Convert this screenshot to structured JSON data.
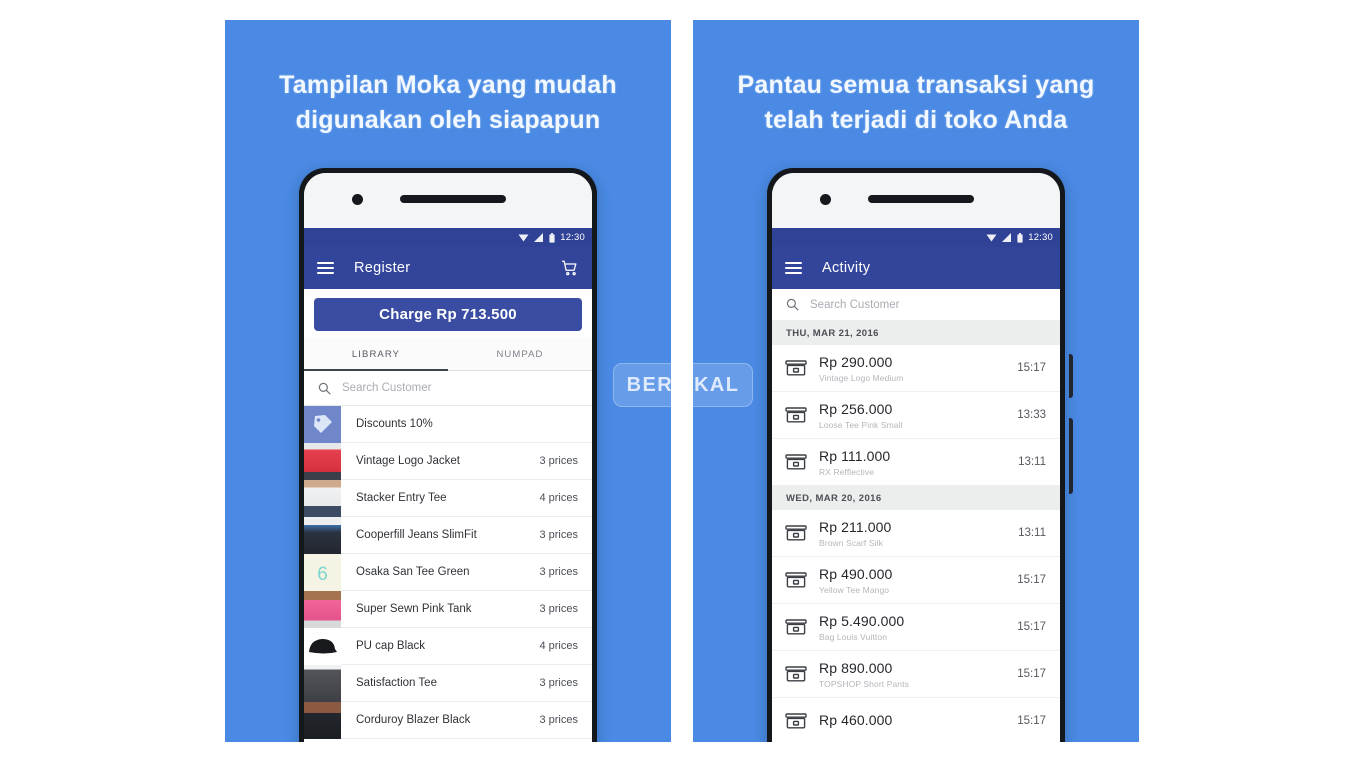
{
  "theme": {
    "panel_blue": "#4a8ae4",
    "appbar_navy": "#33449b",
    "statusbar_navy": "#2f4296",
    "charge_button": "#3a4da3",
    "page_background": "#ffffff"
  },
  "watermark": {
    "text_before": "BER",
    "text_after": "KAL",
    "logo_name": "berakal-logo"
  },
  "panels": [
    {
      "heading": "Tampilan Moka yang mudah digunakan oleh siapapun",
      "phone": {
        "status": {
          "time": "12:30",
          "icons": [
            "wifi-icon",
            "signal-icon",
            "battery-icon"
          ]
        },
        "appbar": {
          "menu": "menu-icon",
          "title": "Register",
          "action": "cart-icon"
        },
        "charge_button": "Charge Rp 713.500",
        "tabs": [
          {
            "label": "LIBRARY",
            "active": true
          },
          {
            "label": "NUMPAD",
            "active": false
          }
        ],
        "search": {
          "placeholder": "Search Customer",
          "icon": "search-icon"
        },
        "products": [
          {
            "name": "Discounts 10%",
            "price": "",
            "thumb": "tag"
          },
          {
            "name": "Vintage Logo Jacket",
            "price": "3 prices",
            "thumb": "red-jacket"
          },
          {
            "name": "Stacker Entry Tee",
            "price": "4 prices",
            "thumb": "white-tank"
          },
          {
            "name": "Cooperfill Jeans SlimFit",
            "price": "3 prices",
            "thumb": "dark-jeans"
          },
          {
            "name": "Osaka San Tee Green",
            "price": "3 prices",
            "thumb": "cream-tee"
          },
          {
            "name": "Super Sewn Pink Tank",
            "price": "3 prices",
            "thumb": "pink-tank"
          },
          {
            "name": "PU cap Black",
            "price": "4 prices",
            "thumb": "black-cap"
          },
          {
            "name": "Satisfaction Tee",
            "price": "3 prices",
            "thumb": "grey-tee"
          },
          {
            "name": "Corduroy Blazer Black",
            "price": "3 prices",
            "thumb": "dark-blazer"
          }
        ]
      }
    },
    {
      "heading": "Pantau semua transaksi yang telah terjadi di toko Anda",
      "phone": {
        "status": {
          "time": "12:30",
          "icons": [
            "wifi-icon",
            "signal-icon",
            "battery-icon"
          ]
        },
        "appbar": {
          "menu": "menu-icon",
          "title": "Activity"
        },
        "search": {
          "placeholder": "Search Customer",
          "icon": "search-icon"
        },
        "groups": [
          {
            "date": "THU, MAR 21, 2016",
            "transactions": [
              {
                "amount": "Rp 290.000",
                "item": "Vintage Logo Medium",
                "time": "15:17"
              },
              {
                "amount": "Rp 256.000",
                "item": "Loose Tee Pink Small",
                "time": "13:33"
              },
              {
                "amount": "Rp 111.000",
                "item": "RX Refflective",
                "time": "13:11"
              }
            ]
          },
          {
            "date": "WED, MAR 20, 2016",
            "transactions": [
              {
                "amount": "Rp 211.000",
                "item": "Brown Scarf Silk",
                "time": "13:11"
              },
              {
                "amount": "Rp 490.000",
                "item": "Yellow Tee Mango",
                "time": "15:17"
              },
              {
                "amount": "Rp 5.490.000",
                "item": "Bag Louis Vuitton",
                "time": "15:17"
              },
              {
                "amount": "Rp 890.000",
                "item": "TOPSHOP Short Pants",
                "time": "15:17"
              },
              {
                "amount": "Rp 460.000",
                "item": "",
                "time": "15:17"
              }
            ]
          }
        ]
      }
    }
  ]
}
